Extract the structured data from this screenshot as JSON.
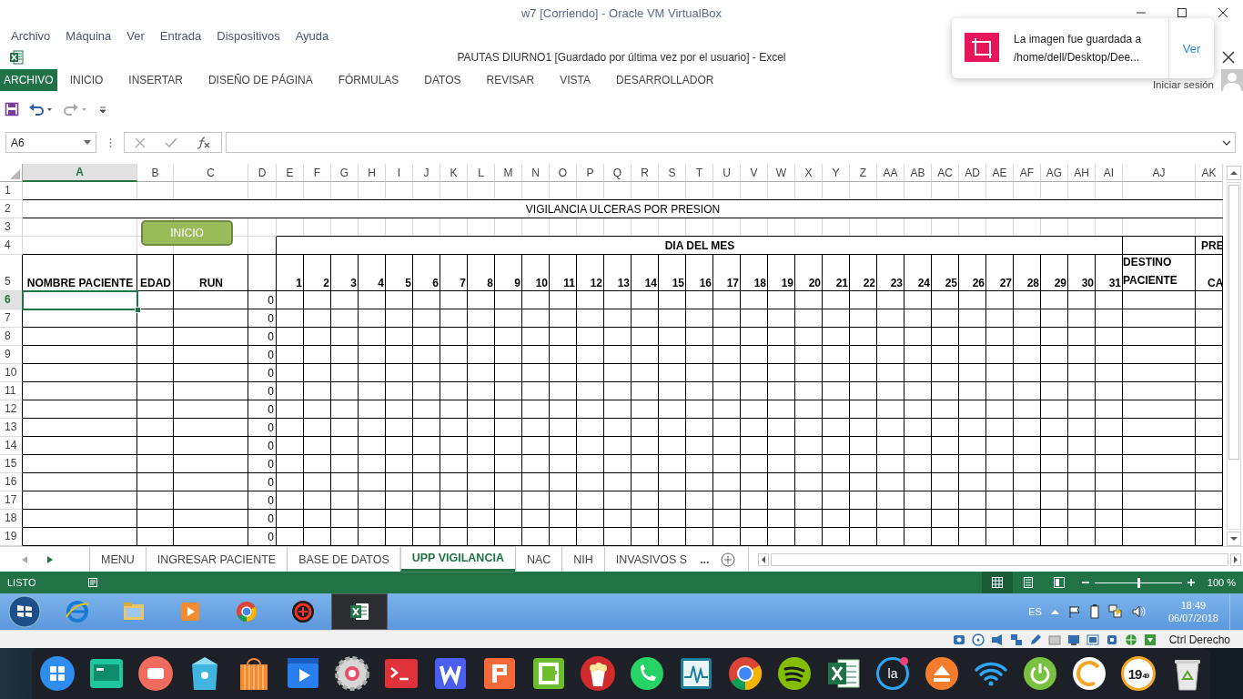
{
  "virtualbox": {
    "title": "w7 [Corriendo] - Oracle VM VirtualBox",
    "menu": [
      "Archivo",
      "Máquina",
      "Ver",
      "Entrada",
      "Dispositivos",
      "Ayuda"
    ],
    "host_key": "Ctrl Derecho"
  },
  "excel": {
    "title": "PAUTAS DIURNO1 [Guardado por última vez por el usuario] - Excel",
    "ribbon_tabs": [
      {
        "label": "ARCHIVO",
        "selected": true
      },
      {
        "label": "INICIO",
        "selected": false
      },
      {
        "label": "INSERTAR",
        "selected": false
      },
      {
        "label": "DISEÑO DE PÁGINA",
        "selected": false
      },
      {
        "label": "FÓRMULAS",
        "selected": false
      },
      {
        "label": "DATOS",
        "selected": false
      },
      {
        "label": "REVISAR",
        "selected": false
      },
      {
        "label": "VISTA",
        "selected": false
      },
      {
        "label": "DESARROLLADOR",
        "selected": false
      }
    ],
    "sign_in": "Iniciar sesión",
    "name_box": "A6"
  },
  "sheet": {
    "columns": [
      {
        "label": "A",
        "selected": true
      },
      {
        "label": "B",
        "selected": false
      },
      {
        "label": "C",
        "selected": false
      },
      {
        "label": "D",
        "selected": false
      },
      {
        "label": "E",
        "selected": false
      },
      {
        "label": "F",
        "selected": false
      },
      {
        "label": "G",
        "selected": false
      },
      {
        "label": "H",
        "selected": false
      },
      {
        "label": "I",
        "selected": false
      },
      {
        "label": "J",
        "selected": false
      },
      {
        "label": "K",
        "selected": false
      },
      {
        "label": "L",
        "selected": false
      },
      {
        "label": "M",
        "selected": false
      },
      {
        "label": "N",
        "selected": false
      },
      {
        "label": "O",
        "selected": false
      },
      {
        "label": "P",
        "selected": false
      },
      {
        "label": "Q",
        "selected": false
      },
      {
        "label": "R",
        "selected": false
      },
      {
        "label": "S",
        "selected": false
      },
      {
        "label": "T",
        "selected": false
      },
      {
        "label": "U",
        "selected": false
      },
      {
        "label": "V",
        "selected": false
      },
      {
        "label": "W",
        "selected": false
      },
      {
        "label": "X",
        "selected": false
      },
      {
        "label": "Y",
        "selected": false
      },
      {
        "label": "Z",
        "selected": false
      },
      {
        "label": "AA",
        "selected": false
      },
      {
        "label": "AB",
        "selected": false
      },
      {
        "label": "AC",
        "selected": false
      },
      {
        "label": "AD",
        "selected": false
      },
      {
        "label": "AE",
        "selected": false
      },
      {
        "label": "AF",
        "selected": false
      },
      {
        "label": "AG",
        "selected": false
      },
      {
        "label": "AH",
        "selected": false
      },
      {
        "label": "AI",
        "selected": false
      },
      {
        "label": "AJ",
        "selected": false
      },
      {
        "label": "AK",
        "selected": false
      }
    ],
    "row_numbers": [
      {
        "label": "1",
        "selected": false
      },
      {
        "label": "2",
        "selected": false
      },
      {
        "label": "3",
        "selected": false
      },
      {
        "label": "4",
        "selected": false
      },
      {
        "label": "5",
        "selected": false
      },
      {
        "label": "6",
        "selected": true
      },
      {
        "label": "7",
        "selected": false
      },
      {
        "label": "8",
        "selected": false
      },
      {
        "label": "9",
        "selected": false
      },
      {
        "label": "10",
        "selected": false
      },
      {
        "label": "11",
        "selected": false
      },
      {
        "label": "12",
        "selected": false
      },
      {
        "label": "13",
        "selected": false
      },
      {
        "label": "14",
        "selected": false
      },
      {
        "label": "15",
        "selected": false
      },
      {
        "label": "16",
        "selected": false
      },
      {
        "label": "17",
        "selected": false
      },
      {
        "label": "18",
        "selected": false
      },
      {
        "label": "19",
        "selected": false
      }
    ],
    "title": "VIGILANCIA ULCERAS POR PRESION",
    "shape_button": "INICIO",
    "group_header": "DIA DEL MES",
    "headers": [
      "NOMBRE PACIENTE",
      "EDAD",
      "RUN"
    ],
    "days": [
      "1",
      "2",
      "3",
      "4",
      "5",
      "6",
      "7",
      "8",
      "9",
      "10",
      "11",
      "12",
      "13",
      "14",
      "15",
      "16",
      "17",
      "18",
      "19",
      "20",
      "21",
      "22",
      "23",
      "24",
      "25",
      "26",
      "27",
      "28",
      "29",
      "30",
      "31"
    ],
    "destination_header": "DESTINO PACIENTE",
    "column_ak_top": "PRE",
    "column_ak_bottom": "CA",
    "data_rows": [
      {
        "column_d": "0",
        "selected": true
      },
      {
        "column_d": "0",
        "selected": false
      },
      {
        "column_d": "0",
        "selected": false
      },
      {
        "column_d": "0",
        "selected": false
      },
      {
        "column_d": "0",
        "selected": false
      },
      {
        "column_d": "0",
        "selected": false
      },
      {
        "column_d": "0",
        "selected": false
      },
      {
        "column_d": "0",
        "selected": false
      },
      {
        "column_d": "0",
        "selected": false
      },
      {
        "column_d": "0",
        "selected": false
      },
      {
        "column_d": "0",
        "selected": false
      },
      {
        "column_d": "0",
        "selected": false
      },
      {
        "column_d": "0",
        "selected": false
      },
      {
        "column_d": "0",
        "selected": false
      }
    ]
  },
  "sheet_tabs": {
    "tabs": [
      {
        "label": "MENU",
        "selected": false
      },
      {
        "label": "INGRESAR PACIENTE",
        "selected": false
      },
      {
        "label": "BASE DE DATOS",
        "selected": false
      },
      {
        "label": "UPP VIGILANCIA",
        "selected": true
      },
      {
        "label": "NAC",
        "selected": false
      },
      {
        "label": "NIH",
        "selected": false
      },
      {
        "label": "INVASIVOS S",
        "selected": false
      }
    ],
    "more": "..."
  },
  "status_bar": {
    "text": "LISTO",
    "views": [
      {
        "kind": "normal",
        "selected": true
      },
      {
        "kind": "page_layout",
        "selected": false
      },
      {
        "kind": "page_break",
        "selected": false
      }
    ],
    "zoom": {
      "level": 0.5,
      "reading": "100 %"
    }
  },
  "taskbar": {
    "apps": [
      {
        "kind": "globe",
        "selected": false
      },
      {
        "kind": "folder",
        "selected": false
      },
      {
        "kind": "player",
        "selected": false
      },
      {
        "kind": "browser",
        "selected": false
      },
      {
        "kind": "emblem",
        "selected": false
      },
      {
        "kind": "spreadsheet",
        "selected": true
      }
    ],
    "language": "ES",
    "time": "18:49",
    "date": "06/07/2018"
  },
  "dock": [
    {
      "kind": "launcher"
    },
    {
      "kind": "window"
    },
    {
      "kind": "record"
    },
    {
      "kind": "store"
    },
    {
      "kind": "shop"
    },
    {
      "kind": "film"
    },
    {
      "kind": "gear"
    },
    {
      "kind": "terminal"
    },
    {
      "kind": "writer"
    },
    {
      "kind": "slides"
    },
    {
      "kind": "sheet"
    },
    {
      "kind": "popcorn"
    },
    {
      "kind": "phone"
    },
    {
      "kind": "pulse"
    },
    {
      "kind": "browser"
    },
    {
      "kind": "music"
    },
    {
      "kind": "spreadsheet"
    },
    {
      "kind": "text_ring",
      "text": "la"
    },
    {
      "kind": "eject"
    },
    {
      "kind": "wifi"
    },
    {
      "kind": "power"
    },
    {
      "kind": "arc"
    },
    {
      "kind": "clock",
      "hours": "19",
      "minutes": "49"
    },
    {
      "kind": "trash"
    }
  ],
  "notification": {
    "message": "La imagen fue guardada a\n/home/dell/Desktop/Dee...",
    "action": "Ver"
  }
}
